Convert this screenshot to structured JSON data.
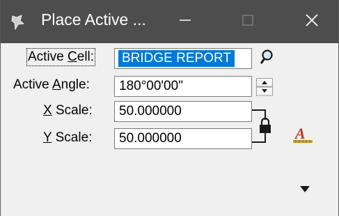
{
  "window": {
    "title": "Place Active ..."
  },
  "titlebar_buttons": {
    "minimize": "minimize",
    "maximize": "maximize",
    "close": "close"
  },
  "fields": {
    "active_cell": {
      "label_pre": "Active ",
      "label_key": "C",
      "label_post": "ell:",
      "value": "BRIDGE REPORT"
    },
    "active_angle": {
      "label_pre": "Active ",
      "label_key": "A",
      "label_post": "ngle:",
      "value": "180°00'00\""
    },
    "x_scale": {
      "label_key": "X",
      "label_post": " Scale:",
      "value": "50.000000"
    },
    "y_scale": {
      "label_key": "Y",
      "label_post": " Scale:",
      "value": "50.000000"
    }
  },
  "icons": {
    "browse": "magnifier-icon",
    "spinner": "spinner-updown-icon",
    "lock": "lock-icon",
    "font": "font-settings-icon",
    "expand": "dropdown-triangle-icon"
  },
  "colors": {
    "titlebar": "#4d4d4d",
    "selection": "#0078d7",
    "font_icon_red": "#c0392b",
    "font_icon_gold": "#c8a030"
  }
}
